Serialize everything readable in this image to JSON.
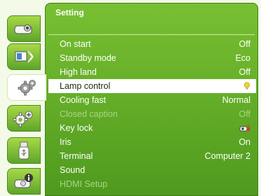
{
  "menu": {
    "title": "Setting",
    "items": [
      {
        "label": "On start",
        "value": "Off"
      },
      {
        "label": "Standby mode",
        "value": "Eco"
      },
      {
        "label": "High land",
        "value": "Off"
      },
      {
        "label": "Lamp control",
        "value": "",
        "value_icon": "lamp-icon"
      },
      {
        "label": "Cooling fast",
        "value": "Normal"
      },
      {
        "label": "Closed caption",
        "value": "Off"
      },
      {
        "label": "Key lock",
        "value": "",
        "value_icon": "projector-lock-icon"
      },
      {
        "label": "Iris",
        "value": "On"
      },
      {
        "label": "Terminal",
        "value": "Computer 2"
      },
      {
        "label": "Sound",
        "value": ""
      },
      {
        "label": "HDMI Setup",
        "value": ""
      }
    ],
    "selected_index": 3,
    "disabled_indexes": [
      5,
      10
    ]
  },
  "sidebar": {
    "tabs": [
      {
        "icon": "projector-icon"
      },
      {
        "icon": "display-adjust-icon"
      },
      {
        "icon": "settings-gear-icon"
      },
      {
        "icon": "extended-gears-icon"
      },
      {
        "icon": "usb-icon"
      },
      {
        "icon": "projector-info-icon"
      }
    ],
    "active_index": 2
  },
  "colors": {
    "panel_green": "#5ea52a",
    "background": "#f3fbe8",
    "highlight": "#ffffff",
    "disabled_text": "#a9d585",
    "lamp_yellow": "#f2d22e",
    "lock_red": "#d23a2a"
  }
}
